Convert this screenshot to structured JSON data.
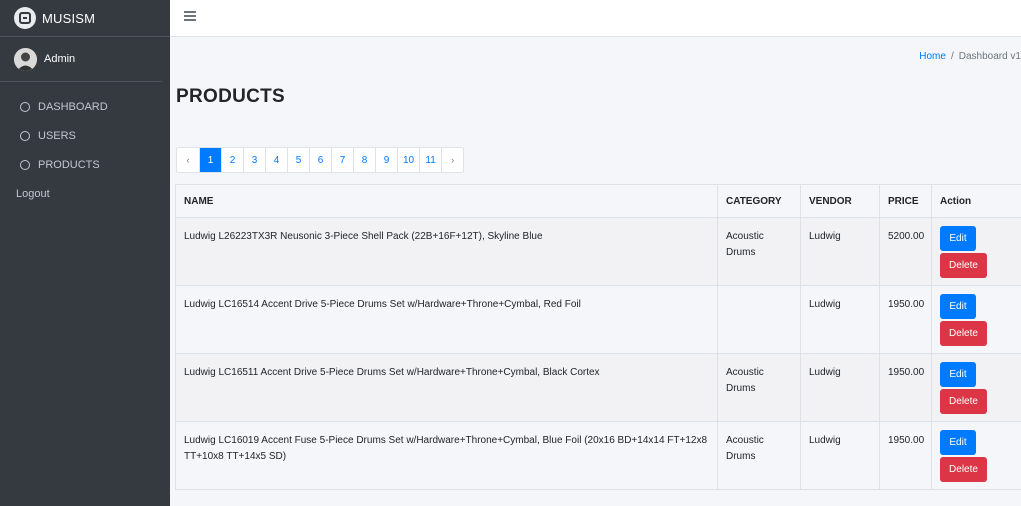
{
  "app": {
    "brand": "MUSISM",
    "user": "Admin"
  },
  "sidebar": {
    "items": [
      {
        "label": "DASHBOARD"
      },
      {
        "label": "USERS"
      },
      {
        "label": "PRODUCTS"
      }
    ],
    "logout": "Logout"
  },
  "breadcrumb": {
    "home": "Home",
    "separator": "/",
    "current": "Dashboard v1"
  },
  "page": {
    "title": "PRODUCTS"
  },
  "pagination": {
    "prev": "‹",
    "next": "›",
    "pages": [
      "1",
      "2",
      "3",
      "4",
      "5",
      "6",
      "7",
      "8",
      "9",
      "10",
      "11"
    ],
    "active": "1"
  },
  "table": {
    "headers": {
      "name": "NAME",
      "category": "CATEGORY",
      "vendor": "VENDOR",
      "price": "PRICE",
      "action": "Action"
    },
    "edit_label": "Edit",
    "delete_label": "Delete",
    "rows": [
      {
        "name": "Ludwig L26223TX3R Neusonic 3-Piece Shell Pack (22B+16F+12T), Skyline Blue",
        "category": "Acoustic Drums",
        "vendor": "Ludwig",
        "price": "5200.00"
      },
      {
        "name": "Ludwig LC16514 Accent Drive 5-Piece Drums Set w/Hardware+Throne+Cymbal, Red Foil",
        "category": "",
        "vendor": "Ludwig",
        "price": "1950.00"
      },
      {
        "name": "Ludwig LC16511 Accent Drive 5-Piece Drums Set w/Hardware+Throne+Cymbal, Black Cortex",
        "category": "Acoustic Drums",
        "vendor": "Ludwig",
        "price": "1950.00"
      },
      {
        "name": "Ludwig LC16019 Accent Fuse 5-Piece Drums Set w/Hardware+Throne+Cymbal, Blue Foil (20x16 BD+14x14 FT+12x8 TT+10x8 TT+14x5 SD)",
        "category": "Acoustic Drums",
        "vendor": "Ludwig",
        "price": "1950.00"
      }
    ]
  },
  "colors": {
    "sidebar": "#343a40",
    "primary": "#007bff",
    "danger": "#dc3545"
  }
}
